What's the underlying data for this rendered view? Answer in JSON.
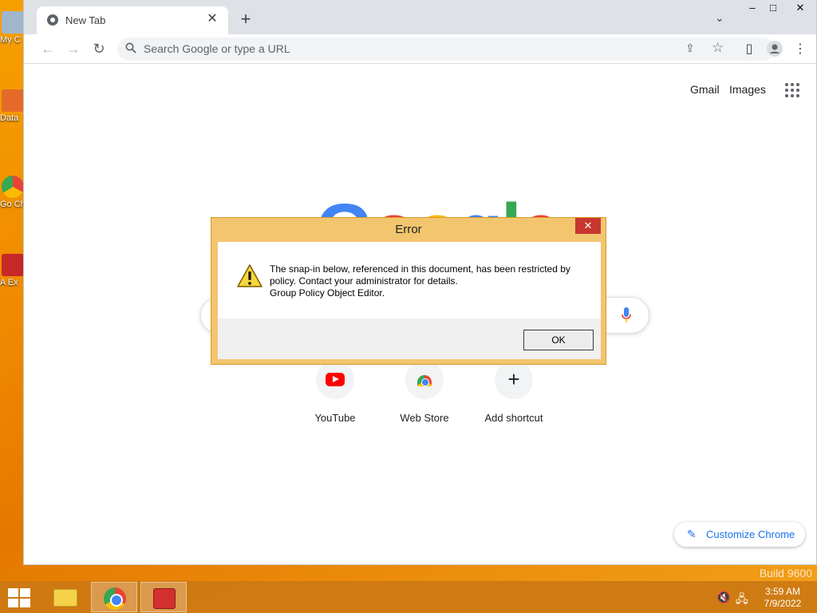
{
  "desktop": {
    "icons": [
      {
        "label": "My C"
      },
      {
        "label": "Data"
      },
      {
        "label": "Go Ch"
      },
      {
        "label": "A Ex"
      }
    ],
    "watermark": "Build 9600"
  },
  "browser": {
    "tab_title": "New Tab",
    "omnibox_placeholder": "Search Google or type a URL",
    "window_controls": {
      "minimize": "‒",
      "maximize": "□",
      "close": "✕"
    }
  },
  "newtab": {
    "links": {
      "gmail": "Gmail",
      "images": "Images"
    },
    "logo_letters": [
      {
        "ch": "G",
        "color": "#4285f4"
      },
      {
        "ch": "o",
        "color": "#ea4335"
      },
      {
        "ch": "o",
        "color": "#fbbc05"
      },
      {
        "ch": "g",
        "color": "#4285f4"
      },
      {
        "ch": "l",
        "color": "#34a853"
      },
      {
        "ch": "e",
        "color": "#ea4335"
      }
    ],
    "shortcuts": [
      {
        "label": "YouTube",
        "icon": "youtube-icon"
      },
      {
        "label": "Web Store",
        "icon": "chrome-web-store-icon"
      },
      {
        "label": "Add shortcut",
        "icon": "plus-icon"
      }
    ],
    "customize_label": "Customize Chrome"
  },
  "dialog": {
    "title": "Error",
    "message_lines": [
      "The snap-in below, referenced in this document, has been restricted by",
      "policy. Contact your administrator for details.",
      "Group Policy Object Editor."
    ],
    "ok_label": "OK",
    "icon": "warning-icon"
  },
  "taskbar": {
    "items": [
      "file-explorer-icon",
      "chrome-icon",
      "toolbox-icon"
    ],
    "clock": {
      "time": "3:59 AM",
      "date": "7/9/2022"
    }
  },
  "colors": {
    "desktop_bg": "#f08a00",
    "dialog_frame": "#f2c56e",
    "dialog_close": "#c7372f",
    "accent_blue": "#1a73e8"
  }
}
